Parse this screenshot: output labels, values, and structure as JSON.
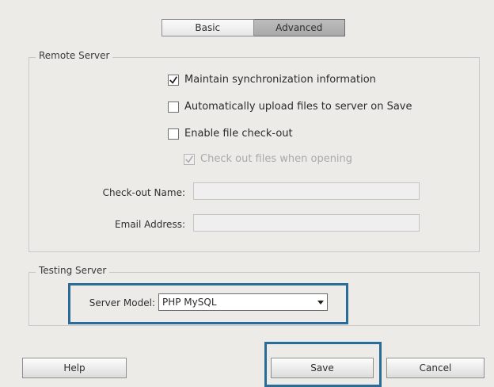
{
  "tabs": {
    "basic": "Basic",
    "advanced": "Advanced"
  },
  "remote_server": {
    "legend": "Remote Server",
    "maintain_sync": "Maintain synchronization information",
    "auto_upload": "Automatically upload files to server on Save",
    "enable_checkout": "Enable file check-out",
    "open_files": "Check out files when opening",
    "checkout_name_label": "Check-out Name:",
    "email_label": "Email Address:"
  },
  "testing_server": {
    "legend": "Testing Server",
    "server_model_label": "Server Model:",
    "server_model_value": "PHP MySQL"
  },
  "buttons": {
    "help": "Help",
    "save": "Save",
    "cancel": "Cancel"
  },
  "colors": {
    "highlight": "#2a6c99"
  }
}
